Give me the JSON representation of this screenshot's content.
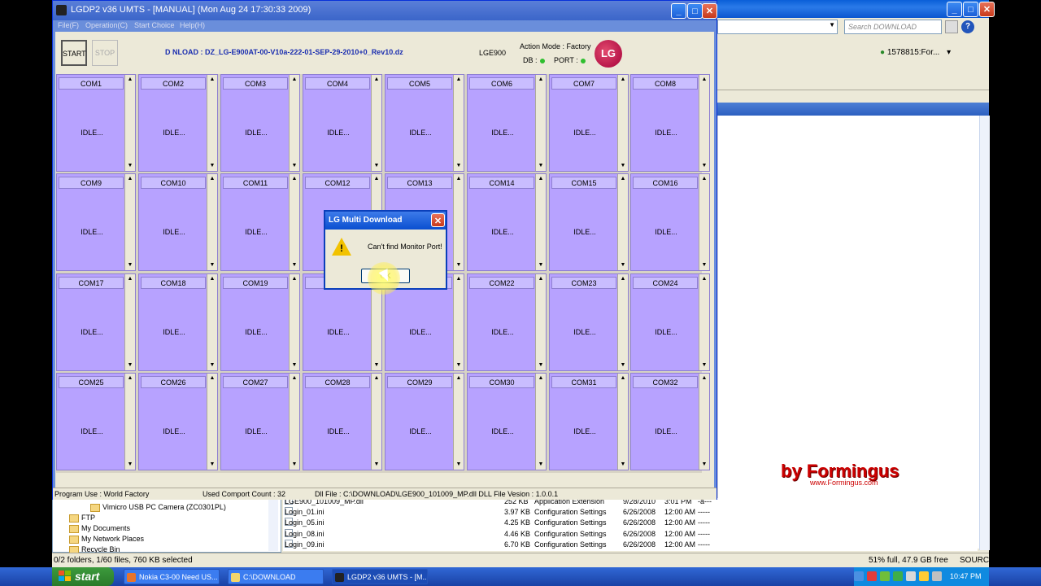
{
  "explorer": {
    "search_placeholder": "Search DOWNLOAD",
    "user_label": "1578815:For...",
    "tree_items": [
      "Vimicro USB PC Camera (ZC0301PL)",
      "FTP",
      "My Documents",
      "My Network Places",
      "Recycle Bin"
    ],
    "files": [
      {
        "name": "LGE900_101009_MP.dll",
        "size": "252 KB",
        "type": "Application Extension",
        "date": "9/28/2010",
        "time": "3:01 PM",
        "attr": "-a---"
      },
      {
        "name": "Login_01.ini",
        "size": "3.97 KB",
        "type": "Configuration Settings",
        "date": "6/26/2008",
        "time": "12:00 AM",
        "attr": "-----"
      },
      {
        "name": "Login_05.ini",
        "size": "4.25 KB",
        "type": "Configuration Settings",
        "date": "6/26/2008",
        "time": "12:00 AM",
        "attr": "-----"
      },
      {
        "name": "Login_08.ini",
        "size": "4.46 KB",
        "type": "Configuration Settings",
        "date": "6/26/2008",
        "time": "12:00 AM",
        "attr": "-----"
      },
      {
        "name": "Login_09.ini",
        "size": "6.70 KB",
        "type": "Configuration Settings",
        "date": "6/26/2008",
        "time": "12:00 AM",
        "attr": "-----"
      }
    ],
    "status_left": "0/2 folders, 1/60 files, 760 KB selected",
    "status_free": "51% full, 47.9 GB free",
    "status_source": "SOURCE"
  },
  "watermark": {
    "main": "by Formingus",
    "sub": "www.Formingus.com"
  },
  "main": {
    "title": "LGDP2 v36 UMTS - [MANUAL] (Mon Aug 24 17:30:33 2009)",
    "menu": [
      "File(F)",
      "Operation(C)",
      "Start Choice",
      "Help(H)"
    ],
    "start_label": "START",
    "stop_label": "STOP",
    "download_label": "D      NLOAD : DZ_LG-E900AT-00-V10a-222-01-SEP-29-2010+0_Rev10.dz",
    "model": "LGE900",
    "action_mode": "Action Mode : Factory",
    "db_label": "DB :",
    "port_label": "PORT :",
    "logo_text": "LG",
    "ports": [
      "COM1",
      "COM2",
      "COM3",
      "COM4",
      "COM5",
      "COM6",
      "COM7",
      "COM8",
      "COM9",
      "COM10",
      "COM11",
      "COM12",
      "COM13",
      "COM14",
      "COM15",
      "COM16",
      "COM17",
      "COM18",
      "COM19",
      "",
      "",
      "COM22",
      "COM23",
      "COM24",
      "COM25",
      "COM26",
      "COM27",
      "COM28",
      "COM29",
      "COM30",
      "COM31",
      "COM32"
    ],
    "port_status": "IDLE...",
    "status_program": "Program Use : World Factory",
    "status_count": "Used Comport Count : 32",
    "status_dll": "Dll File : C:\\DOWNLOAD\\LGE900_101009_MP.dll DLL File Vesion : 1.0.0.1"
  },
  "dialog": {
    "title": "LG Multi Download",
    "message": "Can't find Monitor Port!",
    "ok_label": "OK"
  },
  "taskbar": {
    "start_label": "start",
    "tasks": [
      "Nokia C3-00 Need US...",
      "C:\\DOWNLOAD",
      "LGDP2 v36 UMTS - [M..."
    ],
    "clock": "10:47 PM"
  },
  "colors": {
    "cell_bg": "#b7a2ff",
    "title_blue": "#3b65c9",
    "taskbar_blue": "#1941a5",
    "start_green": "#2a7a2a",
    "download_text": "#1c2fb0",
    "watermark_red": "#cc0000"
  }
}
